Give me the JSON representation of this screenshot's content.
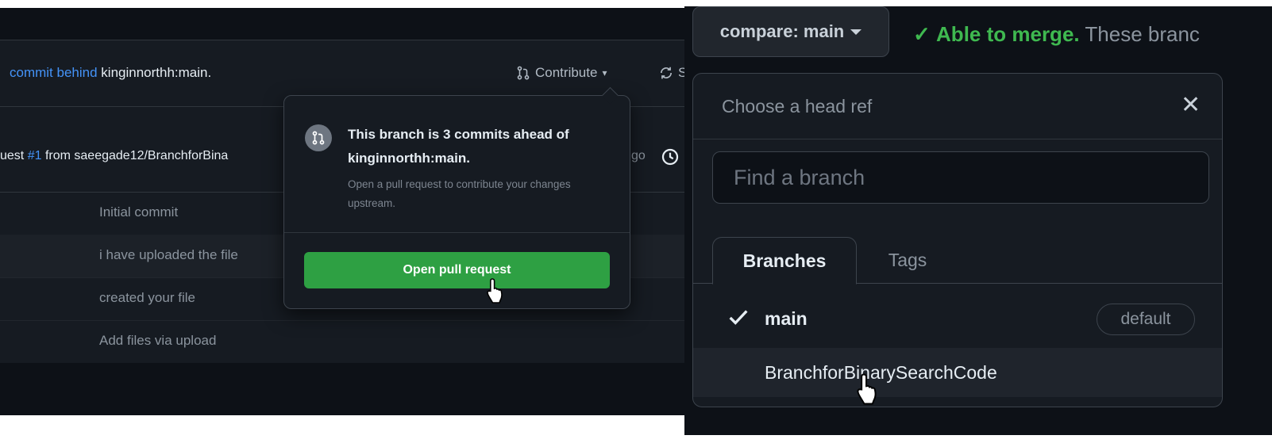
{
  "left": {
    "behind": {
      "link_text": "commit behind",
      "ref": "kinginnorthh:main."
    },
    "contribute_label": "Contribute",
    "sync_label": "Sy",
    "merge_line": {
      "prefix": "uest",
      "pr": "#1",
      "rest": "from saeegade12/BranchforBina",
      "time_fragment": "go"
    },
    "files": [
      {
        "message": "Initial commit"
      },
      {
        "message": "i have uploaded the file"
      },
      {
        "message": "created your file"
      },
      {
        "message": "Add files via upload"
      }
    ]
  },
  "popover": {
    "title": "This branch is 3 commits ahead of kinginnorthh:main.",
    "description": "Open a pull request to contribute your changes upstream.",
    "button_label": "Open pull request"
  },
  "right": {
    "compare_label": "compare: main",
    "merge_status": {
      "ok": "Able to merge.",
      "rest": "These branc"
    },
    "branch_panel": {
      "title": "Choose a head ref",
      "close": "✕",
      "search_placeholder": "Find a branch",
      "tabs": {
        "branches": "Branches",
        "tags": "Tags"
      },
      "rows": [
        {
          "name": "main",
          "badge": "default"
        },
        {
          "name": "BranchforBinarySearchCode"
        }
      ]
    }
  },
  "colors": {
    "accent_green": "#2ea043",
    "link_blue": "#4493f8",
    "bg_dark": "#161b22"
  }
}
